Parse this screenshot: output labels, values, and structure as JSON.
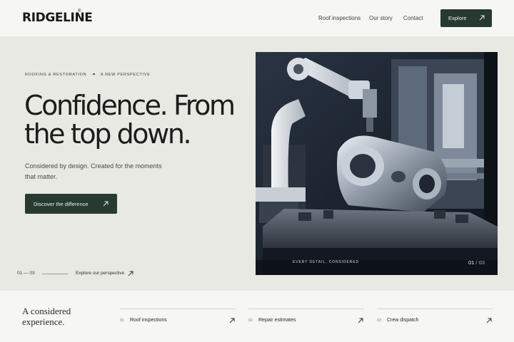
{
  "header": {
    "logo": "RIDGELINE",
    "logo_mark": "®",
    "nav": [
      "Roof inspections",
      "Our story",
      "Contact"
    ],
    "cta_label": "Explore"
  },
  "hero": {
    "kicker_left": "ROOFING & RESTORATION",
    "kicker_right": "A NEW PERSPECTIVE",
    "headline_line1": "Confidence. From",
    "headline_line2": "the top down.",
    "subtext": "Considered by design. Created for the moments that matter.",
    "cta_label": "Discover the difference",
    "counter": "01 — 03",
    "explore_label": "Explore our perspective"
  },
  "image": {
    "caption": "EVERY DETAIL, CONSIDERED",
    "slide_current": "01",
    "slide_separator": " / ",
    "slide_total": "03"
  },
  "bottom": {
    "tagline": "A considered experience.",
    "features": [
      {
        "num": "01",
        "label": "Roof inspections"
      },
      {
        "num": "02",
        "label": "Repair estimates"
      },
      {
        "num": "03",
        "label": "Crew dispatch"
      }
    ]
  },
  "colors": {
    "accent": "#273a2f",
    "background": "#e9e9e3",
    "surface": "#f6f6f3"
  },
  "icons": [
    "arrow-up-right-icon"
  ]
}
